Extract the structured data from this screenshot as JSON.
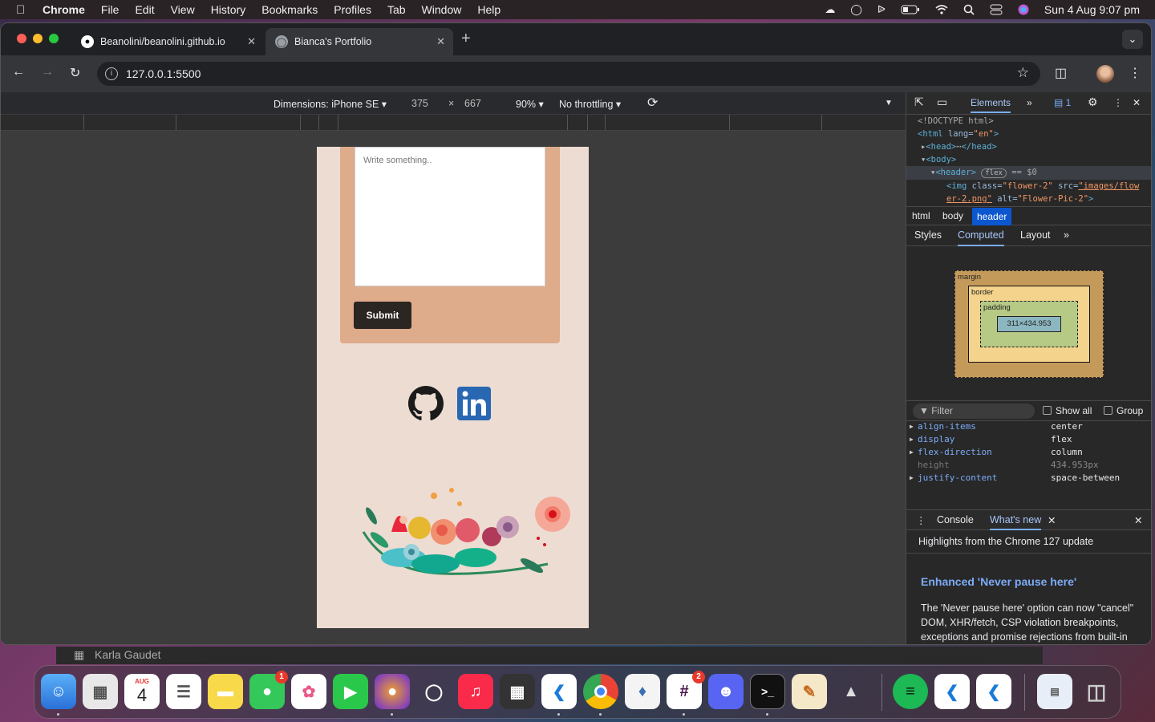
{
  "menubar": {
    "app": "Chrome",
    "items": [
      "File",
      "Edit",
      "View",
      "History",
      "Bookmarks",
      "Profiles",
      "Tab",
      "Window",
      "Help"
    ],
    "clock": "Sun 4 Aug  9:07 pm"
  },
  "browser": {
    "tabs": [
      {
        "title": "Beanolini/beanolini.github.io",
        "favicon": "github-icon"
      },
      {
        "title": "Bianca's Portfolio",
        "favicon": "globe-icon"
      }
    ],
    "url": "127.0.0.1:5500"
  },
  "device_toolbar": {
    "dimensions": "Dimensions: iPhone SE",
    "width": "375",
    "times": "×",
    "height": "667",
    "zoom": "90%",
    "throttling": "No throttling"
  },
  "page": {
    "textarea_placeholder": "Write something..",
    "submit": "Submit"
  },
  "devtools": {
    "tab_elements": "Elements",
    "issues_count": "1",
    "dom": {
      "doctype": "<!DOCTYPE html>",
      "html_open": "<html",
      "lang_attr": "lang=",
      "lang_val": "\"en\"",
      "head": "<head>",
      "head_close": "</head>",
      "body": "<body>",
      "header": "<header>",
      "flex_badge": "flex",
      "eq0": "== $0",
      "img_open": "<img",
      "class_attr": "class=",
      "class_val": "\"flower-2\"",
      "src_attr": "src=",
      "src_val": "\"images/flow",
      "src_val2": "er-2.png\"",
      "alt_attr": "alt=",
      "alt_val": "\"Flower-Pic-2\"",
      "gt": ">"
    },
    "breadcrumbs": [
      "html",
      "body",
      "header"
    ],
    "subtabs": [
      "Styles",
      "Computed",
      "Layout"
    ],
    "boxmodel": {
      "margin": "margin",
      "border": "border",
      "padding": "padding",
      "content": "311×434.953",
      "dash": "–"
    },
    "filter_placeholder": "Filter",
    "show_all": "Show all",
    "group": "Group",
    "properties": [
      {
        "name": "align-items",
        "value": "center"
      },
      {
        "name": "display",
        "value": "flex"
      },
      {
        "name": "flex-direction",
        "value": "column"
      },
      {
        "name": "height",
        "value": "434.953px"
      },
      {
        "name": "justify-content",
        "value": "space-between"
      }
    ],
    "drawer_tabs": [
      "Console",
      "What's new"
    ],
    "whats_new_heading": "Highlights from the Chrome 127 update",
    "whats_new_title": "Enhanced 'Never pause here'",
    "whats_new_body": "The 'Never pause here' option can now \"cancel\" DOM, XHR/fetch, CSP violation breakpoints, exceptions and promise rejections from built-in functions, and more."
  },
  "below_window": {
    "name": "Karla Gaudet"
  },
  "dock": {
    "calendar_month": "AUG",
    "calendar_day": "4",
    "messages_badge": "1",
    "slack_badge": "2"
  }
}
